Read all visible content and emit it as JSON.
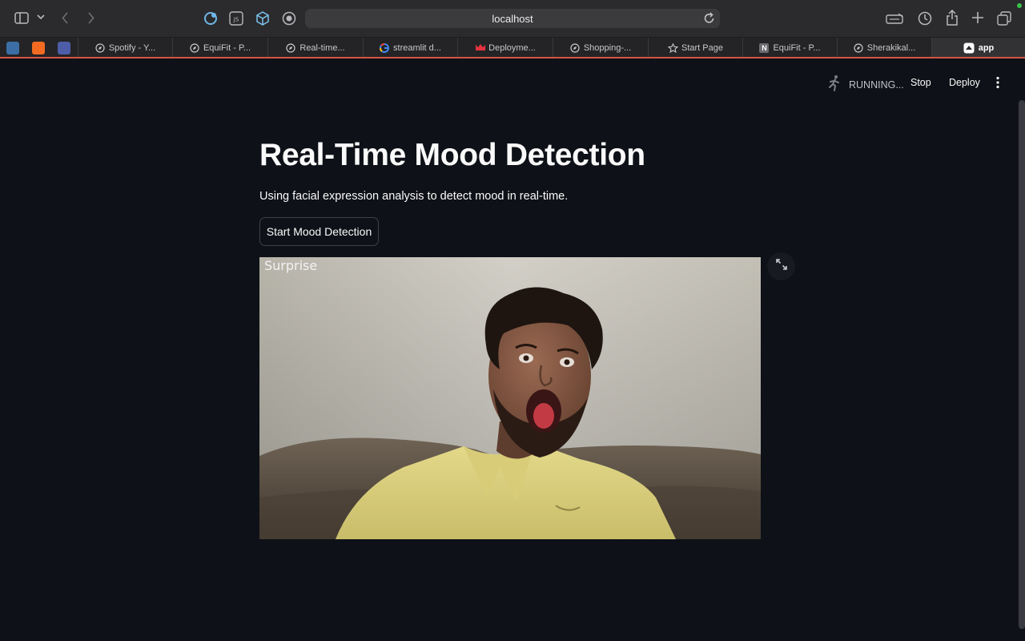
{
  "browser": {
    "url": "localhost",
    "tabs": [
      {
        "label": "Spotify - Y...",
        "icon": "compass-icon"
      },
      {
        "label": "EquiFit - P...",
        "icon": "compass-icon"
      },
      {
        "label": "Real-time...",
        "icon": "compass-icon"
      },
      {
        "label": "streamlit d...",
        "icon": "google-icon"
      },
      {
        "label": "Deployme...",
        "icon": "crown-icon"
      },
      {
        "label": "Shopping-...",
        "icon": "compass-icon"
      },
      {
        "label": "Start Page",
        "icon": "star-icon"
      },
      {
        "label": "EquiFit - P...",
        "icon": "notion-icon"
      },
      {
        "label": "Sherakikal...",
        "icon": "compass-icon"
      },
      {
        "label": "app",
        "icon": "streamlit-icon",
        "active": true
      }
    ]
  },
  "header": {
    "status": "RUNNING...",
    "stop_label": "Stop",
    "deploy_label": "Deploy"
  },
  "main": {
    "title": "Real-Time Mood Detection",
    "subtitle": "Using facial expression analysis to detect mood in real-time.",
    "start_button": "Start Mood Detection",
    "detected_mood": "Surprise"
  },
  "colors": {
    "background": "#0e1117",
    "text": "#fafafa",
    "accent_line": "#d5543f"
  }
}
